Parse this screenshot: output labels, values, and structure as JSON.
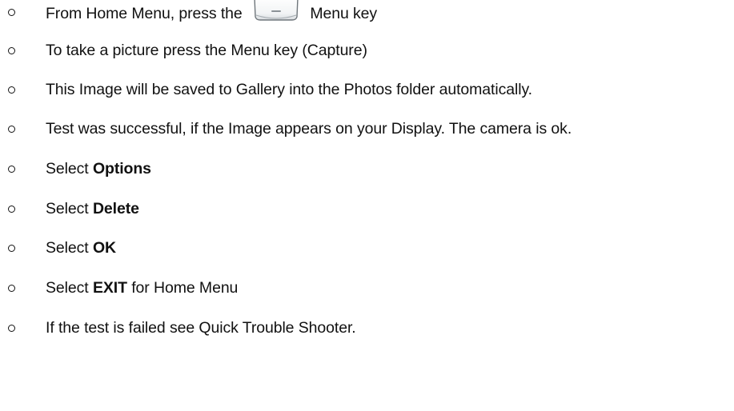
{
  "instructions": [
    {
      "before": "From Home Menu, press the",
      "after": "Menu key",
      "icon": "menu-key-icon"
    },
    {
      "before": "To take a picture press the Menu key (Capture)"
    },
    {
      "before": "This Image will be saved to Gallery into the Photos folder automatically."
    },
    {
      "before": "Test was successful, if the Image appears on your Display. The camera is ok."
    },
    {
      "before": "Select",
      "bold": "Options"
    },
    {
      "before": "Select",
      "bold": "Delete"
    },
    {
      "before": "Select",
      "bold": "OK"
    },
    {
      "before": "Select",
      "bold": "EXIT",
      "after": "for Home Menu"
    },
    {
      "before": "If the test is failed see Quick Trouble Shooter."
    }
  ]
}
